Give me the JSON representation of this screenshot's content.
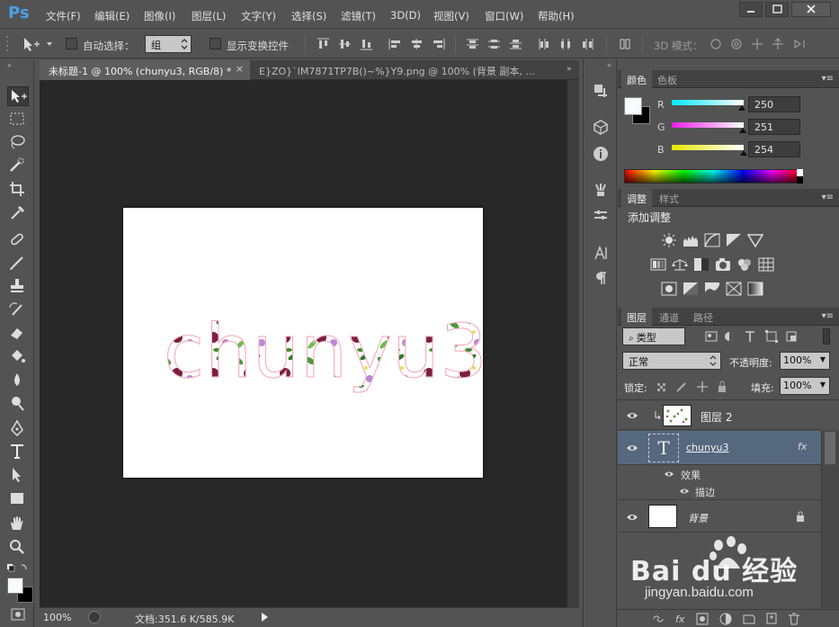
{
  "app": {
    "logo": "Ps",
    "menu": [
      "文件(F)",
      "编辑(E)",
      "图像(I)",
      "图层(L)",
      "文字(Y)",
      "选择(S)",
      "滤镜(T)",
      "3D(D)",
      "视图(V)",
      "窗口(W)",
      "帮助(H)"
    ]
  },
  "options": {
    "auto_select_label": "自动选择：",
    "group_value": "组",
    "show_transform_label": "显示变换控件",
    "mode_3d_label": "3D 模式："
  },
  "tabs": [
    {
      "label": "未标题-1 @ 100% (chunyu3, RGB/8) *"
    },
    {
      "label": "E}ZO}`IM7871TP7B()~%}Y9.png @ 100% (背景 副本, ..."
    }
  ],
  "canvas": {
    "text": "chunyu3",
    "background": "#ffffff"
  },
  "status": {
    "zoom": "100%",
    "doc_info": "文档:351.6 K/585.9K"
  },
  "color_panel": {
    "tabs": [
      "颜色",
      "色板"
    ],
    "channels": [
      {
        "label": "R",
        "value": "250",
        "fraction": 0.98,
        "color": "#00e8ff"
      },
      {
        "label": "G",
        "value": "251",
        "fraction": 0.984,
        "color": "#e81ee8"
      },
      {
        "label": "B",
        "value": "254",
        "fraction": 0.996,
        "color": "#e8e800"
      }
    ]
  },
  "adjust_panel": {
    "tabs": [
      "调整",
      "样式"
    ],
    "title": "添加调整"
  },
  "layers_panel": {
    "tabs": [
      "图层",
      "通道",
      "路径"
    ],
    "filter_kind": "类型",
    "blend_mode": "正常",
    "opacity_label": "不透明度:",
    "opacity_value": "100%",
    "lock_label": "锁定:",
    "fill_label": "填充:",
    "fill_value": "100%",
    "layers": [
      {
        "name": "图层 2"
      },
      {
        "name": "chunyu3",
        "fx": "fx"
      },
      {
        "name": "背景"
      }
    ],
    "effects_label": "效果",
    "stroke_label": "描边"
  },
  "watermark": {
    "brand": "Bai du 经验",
    "url": "jingyan.baidu.com"
  },
  "colors": {
    "accent_blue": "#4aa0e8",
    "selected_layer": "#56687e"
  }
}
